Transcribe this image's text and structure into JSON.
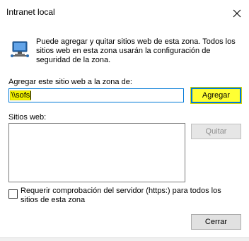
{
  "window": {
    "title": "Intranet local"
  },
  "info": {
    "text": "Puede agregar y quitar sitios web de esta zona. Todos los sitios web en esta zona usarán la configuración de seguridad de la zona."
  },
  "add_site": {
    "label": "Agregar este sitio web a la zona de:",
    "value": "\\\\sofs",
    "button_label": "Agregar"
  },
  "websites": {
    "label": "Sitios web:",
    "items": [],
    "remove_label": "Quitar"
  },
  "require_https": {
    "checked": false,
    "label": "Requerir comprobación del servidor (https:) para todos los sitios de esta zona"
  },
  "footer": {
    "close_label": "Cerrar"
  },
  "colors": {
    "highlight": "#ffff33",
    "focus_border": "#0078d7"
  },
  "icons": {
    "close": "close-icon",
    "zone": "intranet-zone-icon"
  }
}
